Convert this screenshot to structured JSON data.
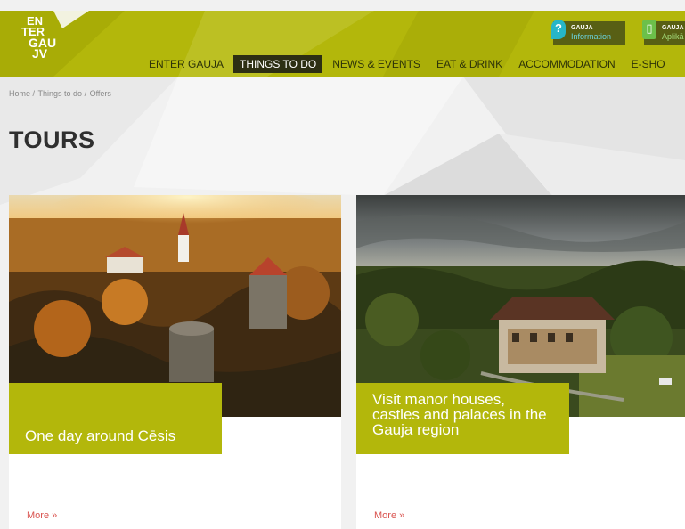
{
  "logo": {
    "line1": "EN",
    "line2": "TER",
    "line3": "GAU",
    "line4": "JV"
  },
  "badges": [
    {
      "icon": "info-pin-icon",
      "title": "GAUJA",
      "subtitle": "Information"
    },
    {
      "icon": "mobile-app-icon",
      "title": "GAUJA",
      "subtitle": "Aplikā"
    }
  ],
  "nav": {
    "items": [
      {
        "label": "ENTER GAUJA",
        "active": false
      },
      {
        "label": "THINGS TO DO",
        "active": true
      },
      {
        "label": "NEWS & EVENTS",
        "active": false
      },
      {
        "label": "EAT & DRINK",
        "active": false
      },
      {
        "label": "ACCOMMODATION",
        "active": false
      },
      {
        "label": "E-SHO",
        "active": false
      }
    ]
  },
  "breadcrumb": {
    "home": "Home",
    "sep1": " / ",
    "things": "Things to do",
    "sep2": " / ",
    "offers": "Offers"
  },
  "page": {
    "title": "TOURS"
  },
  "cards": [
    {
      "caption": "One day around Cēsis",
      "more": "More »"
    },
    {
      "caption": "Visit manor houses, castles and palaces in the Gauja region",
      "more": "More »"
    }
  ],
  "colors": {
    "brand": "#b3b70b",
    "nav_active": "#2d2f13",
    "link": "#d9534f"
  }
}
